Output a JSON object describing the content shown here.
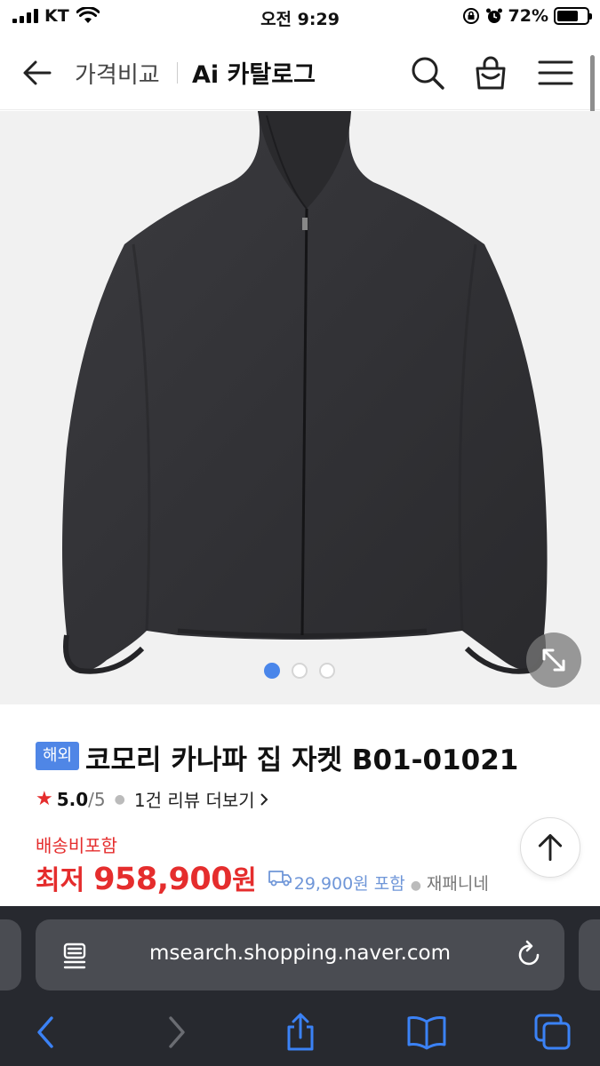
{
  "status_bar": {
    "carrier": "KT",
    "time": "오전 9:29",
    "battery_text": "72%",
    "battery_level": 0.72
  },
  "header": {
    "title_secondary": "가격비교",
    "title_main": "Ai 카탈로그"
  },
  "gallery": {
    "slides_total": 3,
    "active_slide": 1
  },
  "product": {
    "badge": "해외",
    "title": "코모리 카나파 집 자켓 B01-01021",
    "rating": "5.0",
    "rating_max": "/5",
    "review_link": "1건 리뷰 더보기",
    "shipping_note": "배송비포함",
    "price_prefix": "최저",
    "price": "958,900",
    "currency": "원",
    "shipping_fee": "29,900원 포함",
    "seller": "재패니네"
  },
  "browser": {
    "url": "msearch.shopping.naver.com"
  },
  "colors": {
    "accent_red": "#e52d2d",
    "badge_blue": "#4f86e6",
    "toolbar_blue": "#3b82f6"
  }
}
